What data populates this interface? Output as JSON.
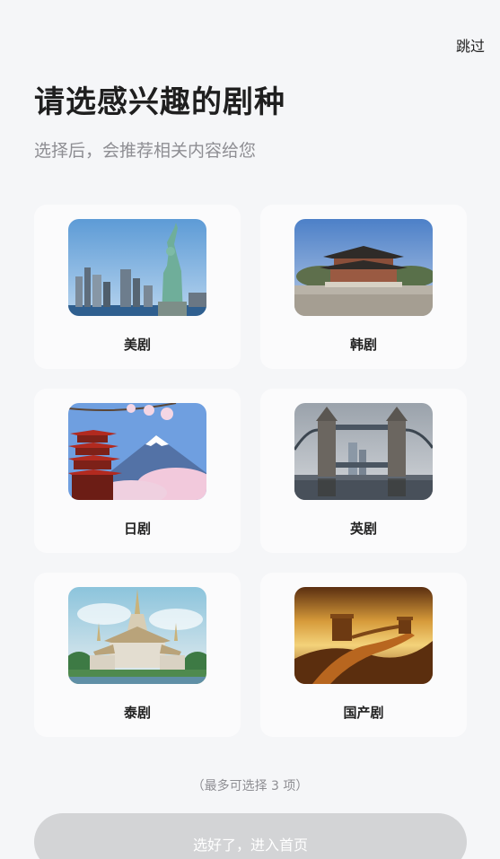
{
  "header": {
    "skip_label": "跳过",
    "title": "请选感兴趣的剧种",
    "subtitle": "选择后，会推荐相关内容给您"
  },
  "genres": [
    {
      "label": "美剧",
      "image": "statue-of-liberty-skyline"
    },
    {
      "label": "韩剧",
      "image": "korean-palace"
    },
    {
      "label": "日剧",
      "image": "mount-fuji-pagoda-sakura"
    },
    {
      "label": "英剧",
      "image": "tower-bridge"
    },
    {
      "label": "泰剧",
      "image": "thai-temple"
    },
    {
      "label": "国产剧",
      "image": "great-wall"
    }
  ],
  "footer": {
    "hint": "（最多可选择 3 项）",
    "confirm_label": "选好了，进入首页"
  }
}
